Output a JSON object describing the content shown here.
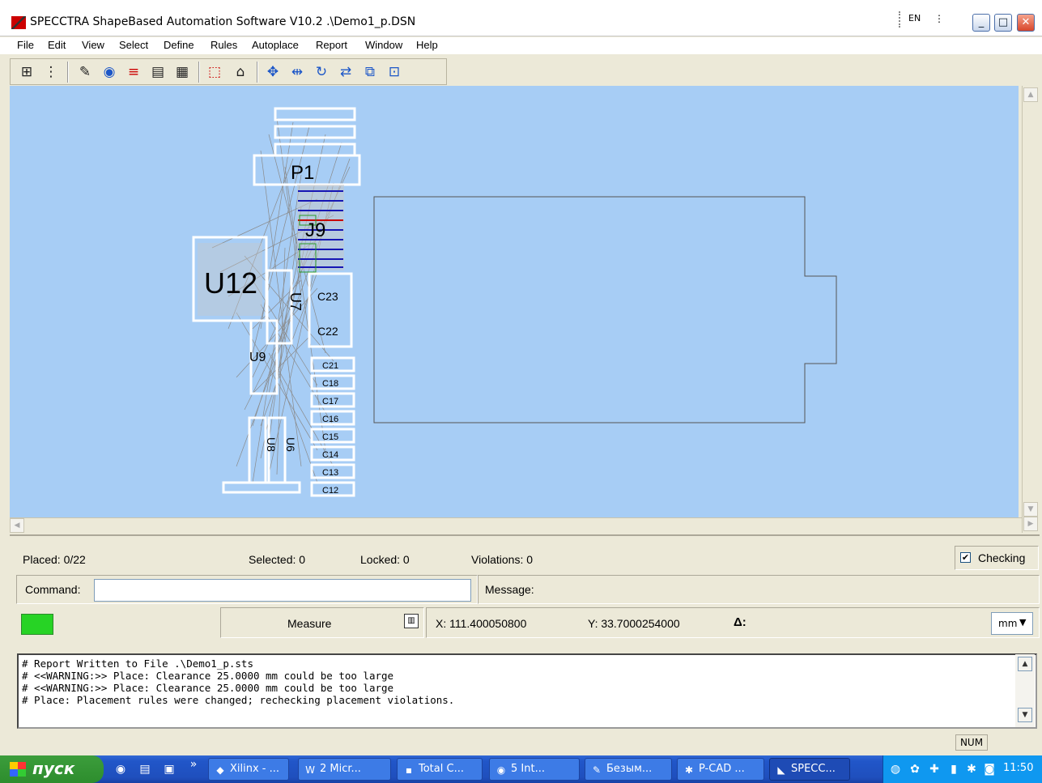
{
  "window": {
    "title": "SPECCTRA ShapeBased Automation Software V10.2 .\\Demo1_p.DSN",
    "lang": "EN",
    "minimize": "_",
    "maximize": "□",
    "close": "✕"
  },
  "menu": [
    "File",
    "Edit",
    "View",
    "Select",
    "Define",
    "Rules",
    "Autoplace",
    "Report",
    "Window",
    "Help"
  ],
  "toolbar_icons": [
    "component-icon",
    "net-icon",
    "pen-icon",
    "globe-icon",
    "layers-icon",
    "document-icon",
    "grid-icon",
    "select-area-icon",
    "lock-icon",
    "move-icon",
    "align-icon",
    "rotate-icon",
    "swap-icon",
    "group-icon",
    "place-icon"
  ],
  "canvas": {
    "background": "#a7cdf5",
    "components": {
      "P1": "P1",
      "J9": "J9",
      "U12": "U12",
      "U7": "U7",
      "U9": "U9",
      "U8": "U8",
      "U6": "U6",
      "caps": [
        "C23",
        "C22",
        "C21",
        "C18",
        "C17",
        "C16",
        "C15",
        "C14",
        "C13",
        "C12"
      ]
    }
  },
  "status": {
    "placed": "Placed: 0/22",
    "selected": "Selected: 0",
    "locked": "Locked: 0",
    "violations": "Violations: 0",
    "checking_label": "Checking",
    "checking_checked": true,
    "command_label": "Command:",
    "command_value": "",
    "message_label": "Message:",
    "measure_label": "Measure",
    "x_coord": "X: 111.400050800",
    "y_coord": "Y: 33.7000254000",
    "delta_label": "Δ:",
    "unit": "mm",
    "go_color": "#27d325"
  },
  "log": [
    "# Report Written to File .\\Demo1_p.sts",
    "# <<WARNING:>> Place: Clearance 25.0000 mm could be too large",
    "# <<WARNING:>> Place: Clearance 25.0000 mm could be too large",
    "# Place: Placement rules were changed; rechecking placement violations."
  ],
  "statusbar": {
    "num": "NUM"
  },
  "taskbar": {
    "start": "пуск",
    "tasks": [
      "Xilinx - ...",
      "2 Micr...",
      "Total C...",
      "5 Int...",
      "Безым...",
      "P-CAD ...",
      "SPECC..."
    ],
    "clock": "11:50"
  }
}
